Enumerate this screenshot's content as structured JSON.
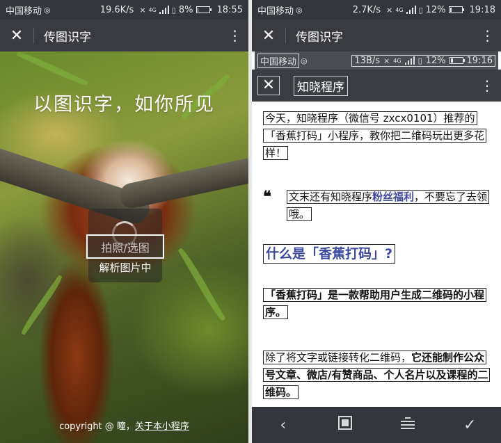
{
  "left": {
    "status": {
      "carrier": "中国移动",
      "speed": "19.6K/s",
      "net": "4G",
      "battery": "8%",
      "time": "18:55",
      "battery_level": 0.08
    },
    "title": "传图识字",
    "slogan": "以图识字，如你所见",
    "photo_button": "拍照/选图",
    "parsing": "解析图片中",
    "copyright_prefix": "copyright @ 瞳，",
    "about_link": "关于本小程序"
  },
  "right": {
    "status": {
      "carrier": "中国移动",
      "speed": "2.7K/s",
      "net": "4G",
      "battery": "12%",
      "time": "19:18",
      "battery_level": 0.12
    },
    "title": "传图识字",
    "inner_status": {
      "carrier": "中国移动",
      "speed": "13B/s",
      "net": "4G",
      "battery": "12%",
      "time": "19:16"
    },
    "inner_title": "知晓程序",
    "article": {
      "p1": "今天，知晓程序（微信号 zxcx0101）推荐的「香蕉打码」小程序，教你把二维码玩出更多花样！",
      "quote_mark": "❝",
      "quote_before": "文末还有知晓程序",
      "quote_highlight": "粉丝福利",
      "quote_after": "，不要忘了去领哦。",
      "heading": "什么是「香蕉打码」?",
      "p2": "「香蕉打码」是一款帮助用户生成二维码的小程序。",
      "p3_normal": "除了将文字或链接转化二维码，",
      "p3_bold": "它还能制作公众号文章、微店/有赞商品、个人名片以及课程的二维码。"
    }
  },
  "colors": {
    "topbar": "#393b41",
    "statusbar": "#33363c",
    "heading": "#3b4aa0",
    "highlight": "#3f4a9a"
  }
}
